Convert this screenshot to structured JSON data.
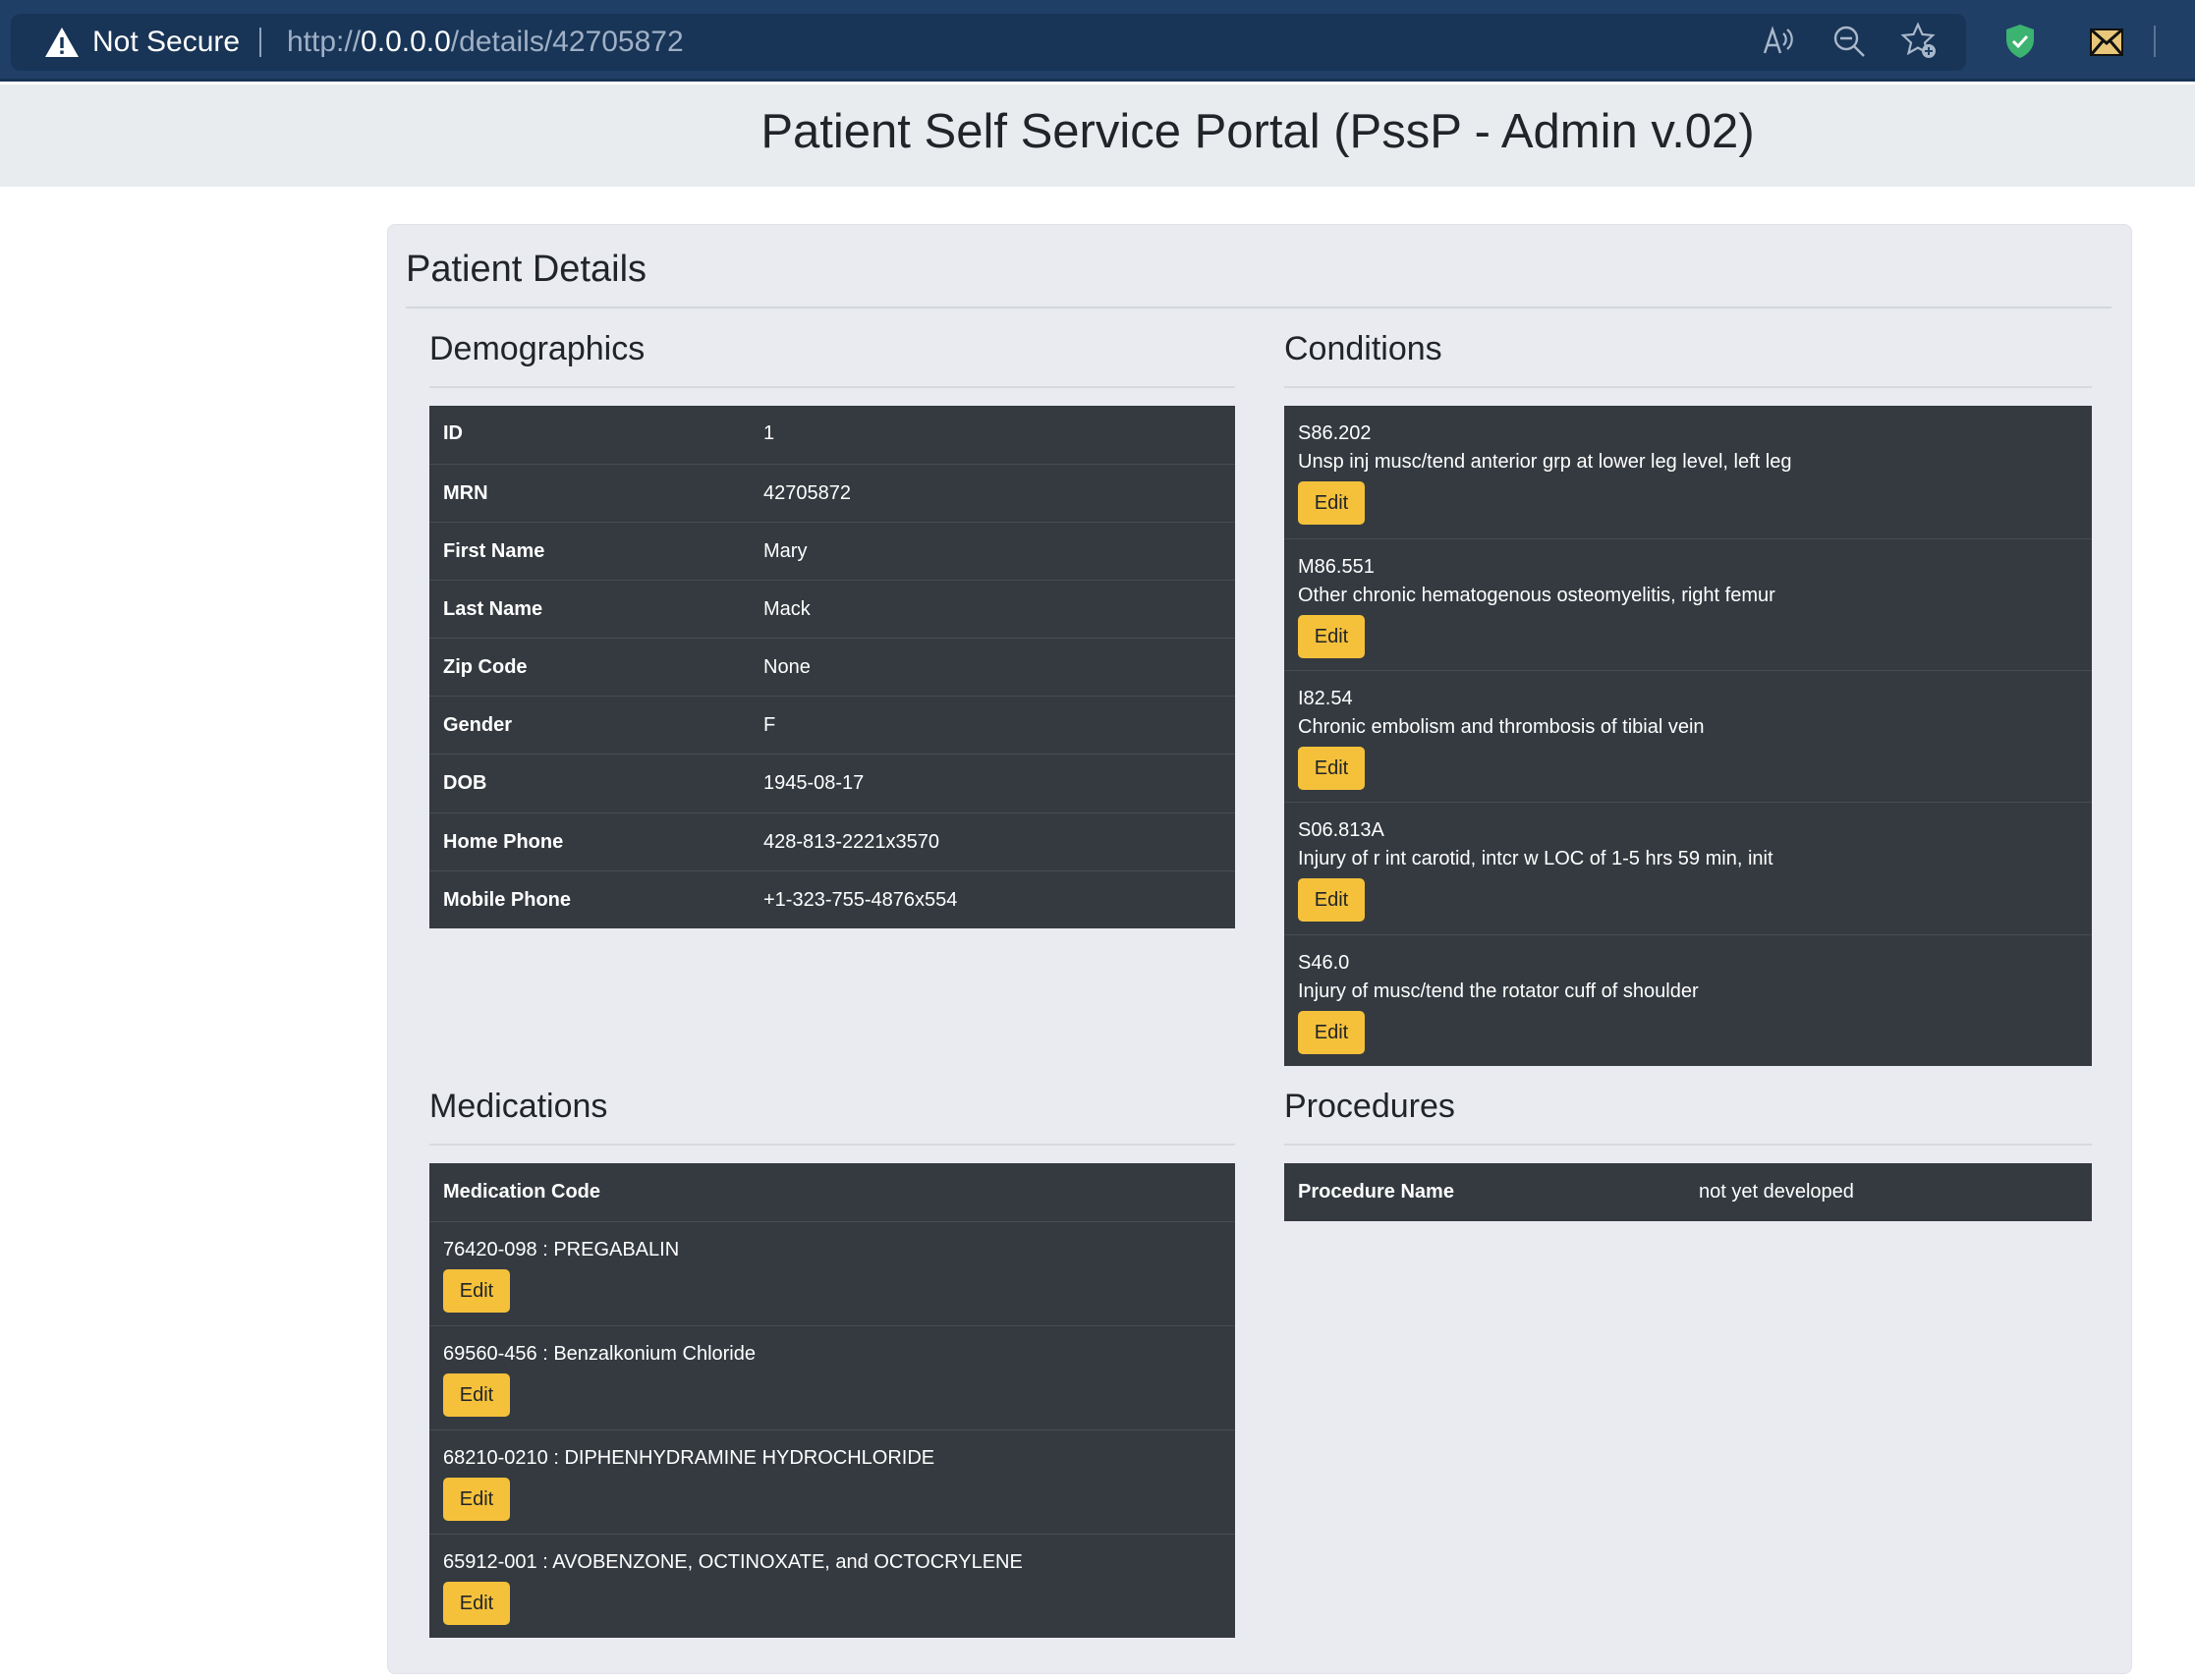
{
  "browser": {
    "security_label": "Not Secure",
    "url_scheme": "http://",
    "url_host": "0.0.0.0",
    "url_path": "/details/42705872",
    "toolbar_icons": [
      "read-aloud-icon",
      "zoom-out-icon",
      "add-favorite-icon",
      "shield-extension-icon",
      "mail-extension-icon"
    ]
  },
  "header": {
    "title": "Patient Self Service Portal (PssP - Admin v.02)"
  },
  "card": {
    "title": "Patient Details"
  },
  "demographics": {
    "title": "Demographics",
    "rows": [
      {
        "label": "ID",
        "value": "1"
      },
      {
        "label": "MRN",
        "value": "42705872"
      },
      {
        "label": "First Name",
        "value": "Mary"
      },
      {
        "label": "Last Name",
        "value": "Mack"
      },
      {
        "label": "Zip Code",
        "value": "None"
      },
      {
        "label": "Gender",
        "value": "F"
      },
      {
        "label": "DOB",
        "value": "1945-08-17"
      },
      {
        "label": "Home Phone",
        "value": "428-813-2221x3570"
      },
      {
        "label": "Mobile Phone",
        "value": "+1-323-755-4876x554"
      }
    ]
  },
  "conditions": {
    "title": "Conditions",
    "edit_label": "Edit",
    "items": [
      {
        "code": "S86.202",
        "description": "Unsp inj musc/tend anterior grp at lower leg level, left leg"
      },
      {
        "code": "M86.551",
        "description": "Other chronic hematogenous osteomyelitis, right femur"
      },
      {
        "code": "I82.54",
        "description": "Chronic embolism and thrombosis of tibial vein"
      },
      {
        "code": "S06.813A",
        "description": "Injury of r int carotid, intcr w LOC of 1-5 hrs 59 min, init"
      },
      {
        "code": "S46.0",
        "description": "Injury of musc/tend the rotator cuff of shoulder"
      }
    ]
  },
  "medications": {
    "title": "Medications",
    "header": "Medication Code",
    "edit_label": "Edit",
    "items": [
      "76420-098 : PREGABALIN",
      "69560-456 : Benzalkonium Chloride",
      "68210-0210 : DIPHENHYDRAMINE HYDROCHLORIDE",
      "65912-001 : AVOBENZONE, OCTINOXATE, and OCTOCRYLENE"
    ]
  },
  "procedures": {
    "title": "Procedures",
    "label": "Procedure Name",
    "value": "not yet developed"
  },
  "colors": {
    "chrome": "#1f3f66",
    "panel": "#343a40",
    "edit_button": "#f5c13b",
    "header_band": "#e9ecef"
  }
}
